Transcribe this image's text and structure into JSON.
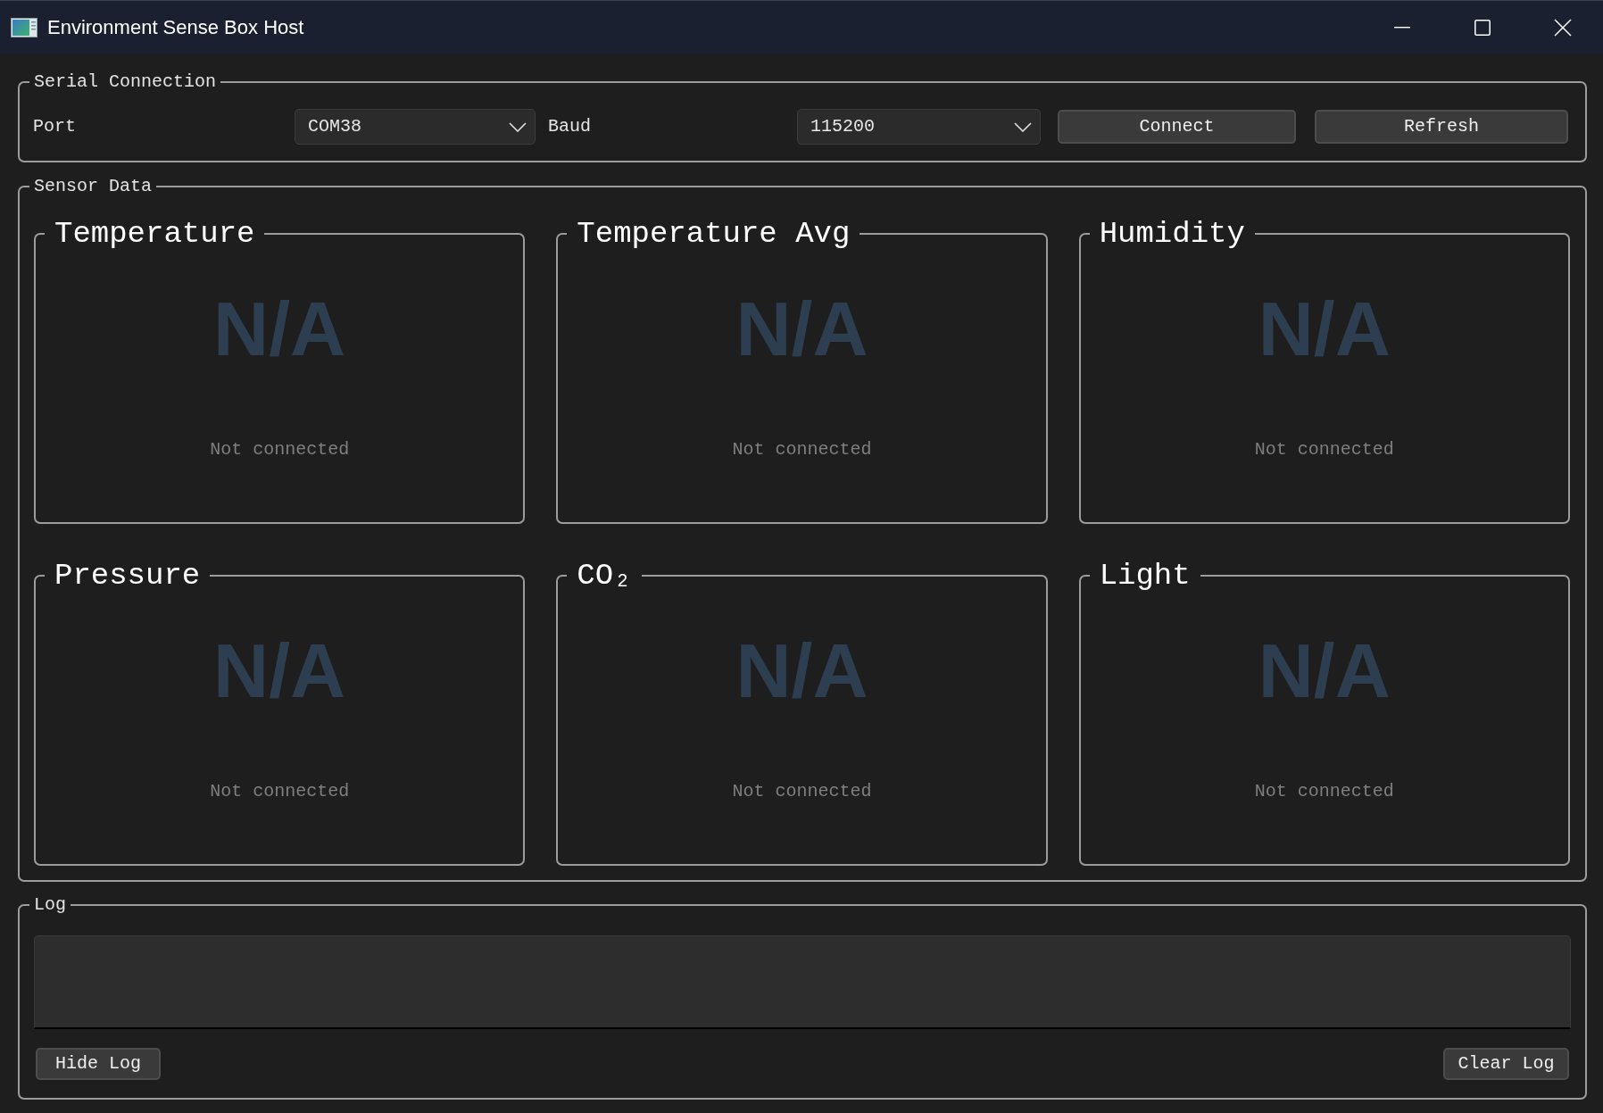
{
  "window": {
    "title": "Environment Sense Box Host"
  },
  "serial_connection": {
    "title": "Serial Connection",
    "port_label": "Port",
    "port": {
      "value": "COM38"
    },
    "baud_label": "Baud",
    "baud": {
      "value": "115200"
    },
    "buttons": [
      "Connect",
      "Refresh"
    ]
  },
  "sensor_data": {
    "title": "Sensor Data",
    "sensors": [
      {
        "title": "Temperature",
        "value": "N/A",
        "status": "Not connected"
      },
      {
        "title": "Temperature Avg",
        "value": "N/A",
        "status": "Not connected"
      },
      {
        "title": "Humidity",
        "value": "N/A",
        "status": "Not connected"
      },
      {
        "title": "Pressure",
        "value": "N/A",
        "status": "Not connected"
      },
      {
        "title": "CO₂",
        "value": "N/A",
        "status": "Not connected"
      },
      {
        "title": "Light",
        "value": "N/A",
        "status": "Not connected"
      }
    ]
  },
  "log": {
    "title": "Log",
    "buttons": [
      "Hide Log",
      "Clear Log"
    ]
  }
}
